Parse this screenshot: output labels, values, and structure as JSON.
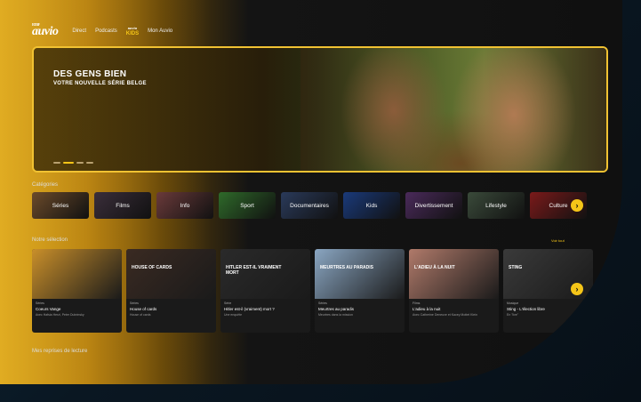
{
  "app": {
    "logo": "auvio",
    "logo_small": "RTBF"
  },
  "nav": {
    "items": [
      "Direct",
      "Podcasts"
    ],
    "kids_top": "auvio",
    "kids": "KIDS",
    "mon_auvio": "Mon Auvio"
  },
  "hero": {
    "title": "DES GENS BIEN",
    "subtitle": "VOTRE NOUVELLE SÉRIE BELGE",
    "slides": 4,
    "active_slide": 1
  },
  "categories": {
    "heading": "Catégories",
    "items": [
      {
        "label": "Séries",
        "color": "#6b4a2a"
      },
      {
        "label": "Films",
        "color": "#3a2e3a"
      },
      {
        "label": "Info",
        "color": "#6a3a3a"
      },
      {
        "label": "Sport",
        "color": "#2f6a2a"
      },
      {
        "label": "Documentaires",
        "color": "#2a3a5a"
      },
      {
        "label": "Kids",
        "color": "#1a3a7a"
      },
      {
        "label": "Divertissement",
        "color": "#4a2a5a"
      },
      {
        "label": "Lifestyle",
        "color": "#3a4a3a"
      },
      {
        "label": "Culture",
        "color": "#7a1a1a"
      }
    ],
    "next": "›"
  },
  "selection": {
    "heading": "Notre sélection",
    "voir_tout": "Voir tout",
    "items": [
      {
        "tag": "Séries",
        "title": "Coeurs Vange",
        "desc": "Avec Hafsia Herzi, Peter Dubrinsky",
        "thumb": "#c98f2a",
        "overlay": ""
      },
      {
        "tag": "Séries",
        "title": "House of cards",
        "desc": "House of cards",
        "thumb": "#3a2a22",
        "overlay": "HOUSE OF CARDS"
      },
      {
        "tag": "Série",
        "title": "Hitler est-il (vraiment) mort ?",
        "desc": "Une enquête",
        "thumb": "#2a2a2a",
        "overlay": "HITLER EST-IL VRAIMENT MORT"
      },
      {
        "tag": "Séries",
        "title": "Meurtres au paradis",
        "desc": "Meurtres dans la mission",
        "thumb": "#8aa6c2",
        "overlay": "MEURTRES AU PARADIS"
      },
      {
        "tag": "Films",
        "title": "L'adieu à la nuit",
        "desc": "Avec Catherine Deneuve et Kacey Mottet Klein",
        "thumb": "#b07a6a",
        "overlay": "L'ADIEU À LA NUIT"
      },
      {
        "tag": "Musique",
        "title": "Sting - L'élection libre",
        "desc": "En \"live\"",
        "thumb": "#3a3a3a",
        "overlay": "STING"
      }
    ]
  },
  "reprises": {
    "heading": "Mes reprises de lecture"
  },
  "colors": {
    "accent": "#f5c518"
  }
}
